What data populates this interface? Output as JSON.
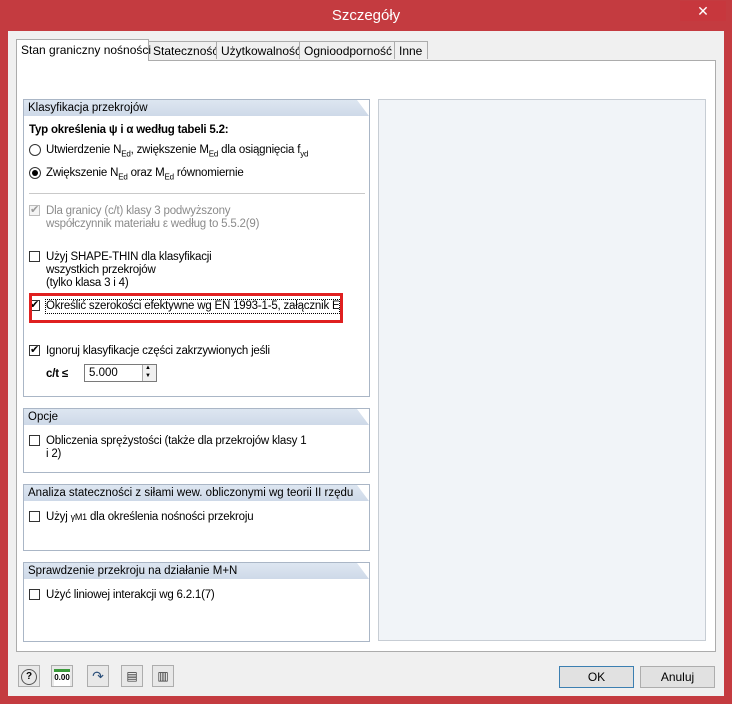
{
  "window": {
    "title": "Szczegóły",
    "close_glyph": "✕"
  },
  "tabs": [
    {
      "label": "Stan graniczny nośności",
      "active": true
    },
    {
      "label": "Stateczność"
    },
    {
      "label": "Użytkowalność"
    },
    {
      "label": "Ognioodporność"
    },
    {
      "label": "Inne"
    }
  ],
  "classification": {
    "header": "Klasyfikacja przekrojów",
    "type_label": "Typ określenia ψ i α według tabeli 5.2:",
    "radio1": "Utwierdzenie N",
    "radio1_sub": "Ed",
    "radio1_rest": ", zwiększenie M",
    "radio1_sub2": "Ed",
    "radio1_rest2": " dla osiągnięcia f",
    "radio1_sub3": "yd",
    "radio2": "Zwiększenie N",
    "radio2_sub": "Ed",
    "radio2_rest": " oraz M",
    "radio2_sub2": "Ed",
    "radio2_rest2": " równomiernie",
    "disabled_line1": "Dla granicy (c/t) klasy 3 podwyższony",
    "disabled_line2": "współczynnik materiału ε według to 5.5.2(9)",
    "shape_line1": "Użyj SHAPE-THIN dla klasyfikacji",
    "shape_line2": "wszystkich przekrojów",
    "shape_line3": "(tylko klasa 3 i 4)",
    "effective_widths": "Określić szerokości efektywne wg EN 1993-1-5, załącznik E",
    "ignore_line": "Ignoruj klasyfikacje części zakrzywionych jeśli",
    "ct_label": "c/t ≤",
    "ct_value": "5.000"
  },
  "options": {
    "header": "Opcje",
    "elastic_line1": "Obliczenia sprężystości (także dla przekrojów klasy 1",
    "elastic_line2": "i 2)"
  },
  "stability": {
    "header": "Analiza stateczności z siłami wew. obliczonymi wg teorii II rzędu",
    "use_gamma": "Użyj ",
    "gamma_symbol": "γM1",
    "gamma_rest": " dla określenia nośności przekroju"
  },
  "check": {
    "header": "Sprawdzenie przekroju na działanie M+N",
    "linear": "Użyć liniowej interakcji wg 6.2.1(7)"
  },
  "footer": {
    "ok": "OK",
    "cancel": "Anuluj",
    "decimals": "0.00",
    "tools": [
      "help-icon",
      "decimals-icon",
      "default-arrow-icon",
      "import-icon",
      "export-icon"
    ]
  }
}
